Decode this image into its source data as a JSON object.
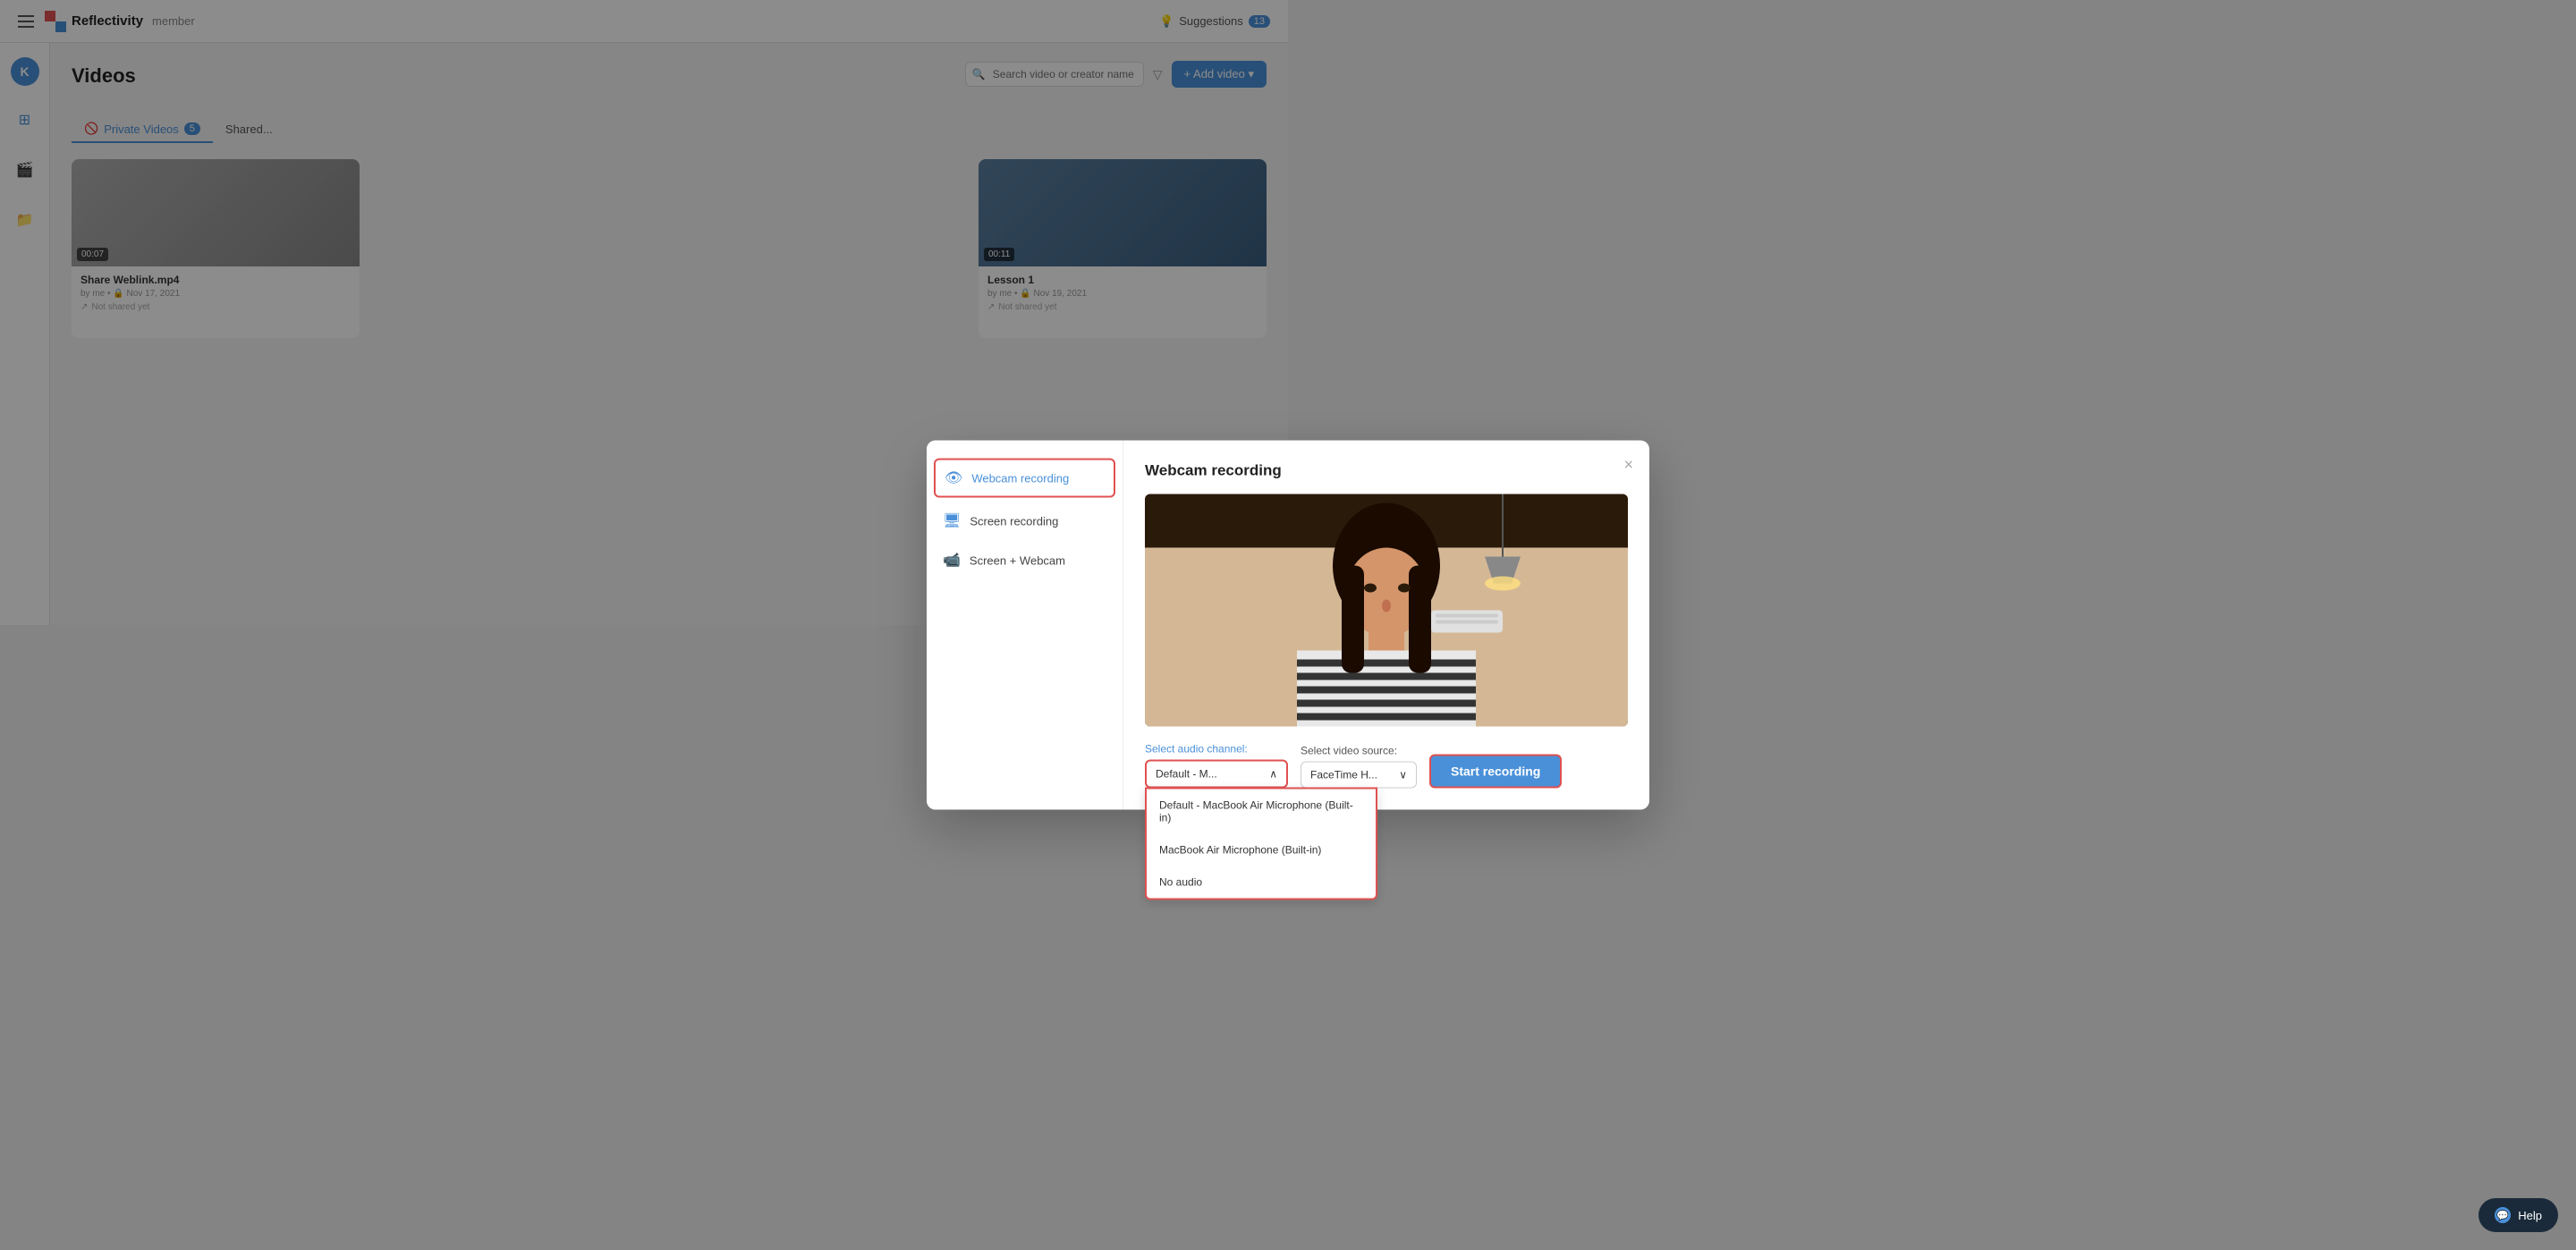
{
  "topnav": {
    "brand": "Reflectivity",
    "role": "member",
    "suggestions_label": "Suggestions",
    "suggestions_count": "13"
  },
  "sidebar": {
    "avatar_letter": "K",
    "items": [
      {
        "id": "dashboard",
        "icon": "⊞"
      },
      {
        "id": "videos",
        "icon": "🎬"
      },
      {
        "id": "folder",
        "icon": "📁"
      }
    ]
  },
  "page": {
    "title": "Videos"
  },
  "tabs": [
    {
      "label": "Private Videos",
      "badge": "5",
      "active": true
    },
    {
      "label": "S...",
      "active": false
    }
  ],
  "toolbar": {
    "add_video_label": "+ Add video ▾",
    "search_placeholder": "Search video or creator name..."
  },
  "videos": [
    {
      "title": "Share Weblink.mp4",
      "meta": "by me • 🔒 Nov 17, 2021",
      "duration": "00:07",
      "status": "Not shared yet",
      "thumb": "dark"
    },
    {
      "title": "Lesson 1",
      "meta": "by me • 🔒 Nov 19, 2021",
      "duration": "00:11",
      "status": "Not shared yet",
      "thumb": "blue"
    }
  ],
  "modal": {
    "title": "Webcam recording",
    "options": [
      {
        "id": "webcam",
        "label": "Webcam recording",
        "icon": "👁",
        "selected": true
      },
      {
        "id": "screen",
        "label": "Screen recording",
        "icon": "🖥",
        "selected": false
      },
      {
        "id": "screen_webcam",
        "label": "Screen + Webcam",
        "icon": "🖥",
        "selected": false
      }
    ],
    "close_label": "×",
    "audio_label": "Select audio channel:",
    "video_label": "Select video source:",
    "audio_value": "Default - M...",
    "video_value": "FaceTime H...",
    "start_label": "Start recording",
    "dropdown_items": [
      "Default - MacBook Air Microphone (Built-in)",
      "MacBook Air Microphone (Built-in)",
      "No audio"
    ]
  }
}
